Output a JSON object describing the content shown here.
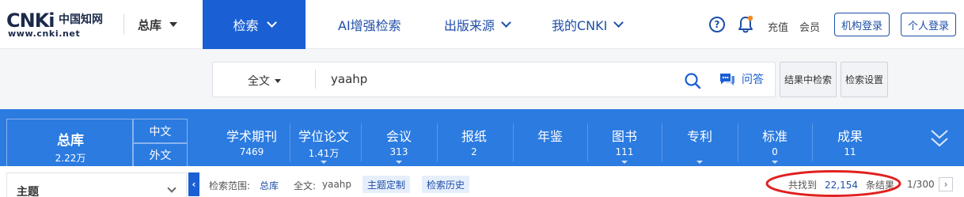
{
  "logo": {
    "main": "CNKi",
    "cn": "中国知网",
    "url": "www.cnki.net"
  },
  "topnav": {
    "db_label": "总库",
    "search_label": "检索",
    "ai_label": "AI增强检索",
    "pub_label": "出版来源",
    "mycnki_label": "我的CNKI",
    "help_glyph": "?",
    "recharge_label": "充值",
    "member_label": "会员",
    "org_login_label": "机构登录",
    "personal_login_label": "个人登录"
  },
  "search": {
    "field_label": "全文",
    "query": "yaahp",
    "qa_label": "问答",
    "search_within_label": "结果中检索",
    "settings_label": "检索设置"
  },
  "categories": {
    "total": {
      "name": "总库",
      "count": "2.22万"
    },
    "lang_cn": "中文",
    "lang_en": "外文",
    "items": [
      {
        "name": "学术期刊",
        "count": "7469"
      },
      {
        "name": "学位论文",
        "count": "1.41万"
      },
      {
        "name": "会议",
        "count": "313"
      },
      {
        "name": "报纸",
        "count": "2"
      },
      {
        "name": "年鉴",
        "count": ""
      },
      {
        "name": "图书",
        "count": "111"
      },
      {
        "name": "专利",
        "count": ""
      },
      {
        "name": "标准",
        "count": "0"
      },
      {
        "name": "成果",
        "count": "11"
      }
    ]
  },
  "results": {
    "topic_label": "主题",
    "collapse_glyph": "‹",
    "scope_label": "检索范围:",
    "scope_value": "总库",
    "fulltext_label": "全文:",
    "fulltext_value": "yaahp",
    "chip_custom": "主题定制",
    "chip_history": "检索历史",
    "found_prefix": "共找到",
    "found_count": "22,154",
    "found_suffix": "条结果",
    "page_info": "1/300",
    "next_glyph": "›"
  },
  "colors": {
    "brand_blue": "#1a5fd4",
    "category_bar": "#2b7be0",
    "nav_text": "#1e4ea8",
    "annotation_red": "#e0211f"
  }
}
